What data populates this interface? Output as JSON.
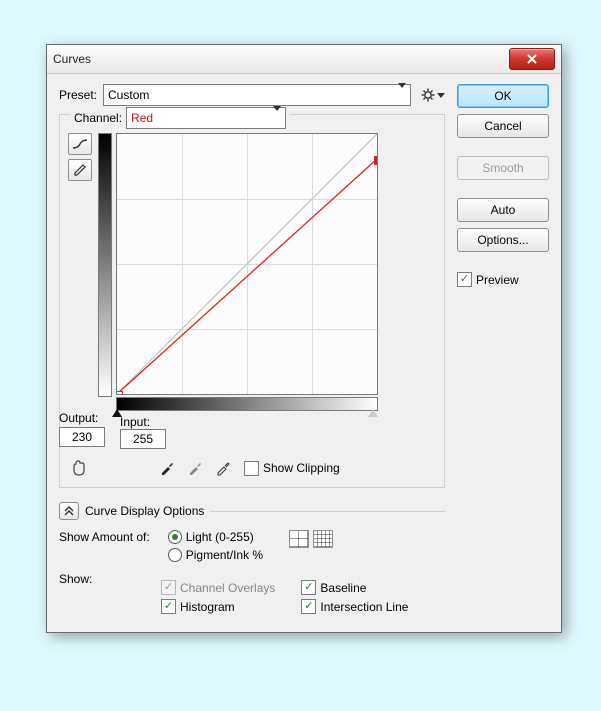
{
  "window": {
    "title": "Curves"
  },
  "preset": {
    "label": "Preset:",
    "value": "Custom"
  },
  "channel": {
    "label": "Channel:",
    "value": "Red"
  },
  "output": {
    "label": "Output:",
    "value": "230"
  },
  "input": {
    "label": "Input:",
    "value": "255"
  },
  "showClipping": {
    "label": "Show Clipping",
    "checked": false
  },
  "curveDisplayHeader": "Curve Display Options",
  "showAmount": {
    "label": "Show Amount of:",
    "options": {
      "light": "Light  (0-255)",
      "pigment": "Pigment/Ink %"
    },
    "selected": "light"
  },
  "show": {
    "label": "Show:",
    "channelOverlays": {
      "label": "Channel Overlays",
      "checked": true,
      "enabled": false
    },
    "histogram": {
      "label": "Histogram",
      "checked": true,
      "enabled": true
    },
    "baseline": {
      "label": "Baseline",
      "checked": true,
      "enabled": true
    },
    "intersection": {
      "label": "Intersection Line",
      "checked": true,
      "enabled": true
    }
  },
  "buttons": {
    "ok": "OK",
    "cancel": "Cancel",
    "smooth": "Smooth",
    "auto": "Auto",
    "options": "Options..."
  },
  "preview": {
    "label": "Preview",
    "checked": true
  },
  "chart_data": {
    "type": "line",
    "title": "Red channel curve",
    "xlabel": "Input",
    "ylabel": "Output",
    "xlim": [
      0,
      255
    ],
    "ylim": [
      0,
      255
    ],
    "baseline": [
      [
        0,
        0
      ],
      [
        255,
        255
      ]
    ],
    "series": [
      {
        "name": "Red",
        "color": "#d22",
        "points": [
          [
            0,
            0
          ],
          [
            255,
            230
          ]
        ]
      }
    ],
    "grid": {
      "xstep": 64,
      "ystep": 64
    }
  }
}
